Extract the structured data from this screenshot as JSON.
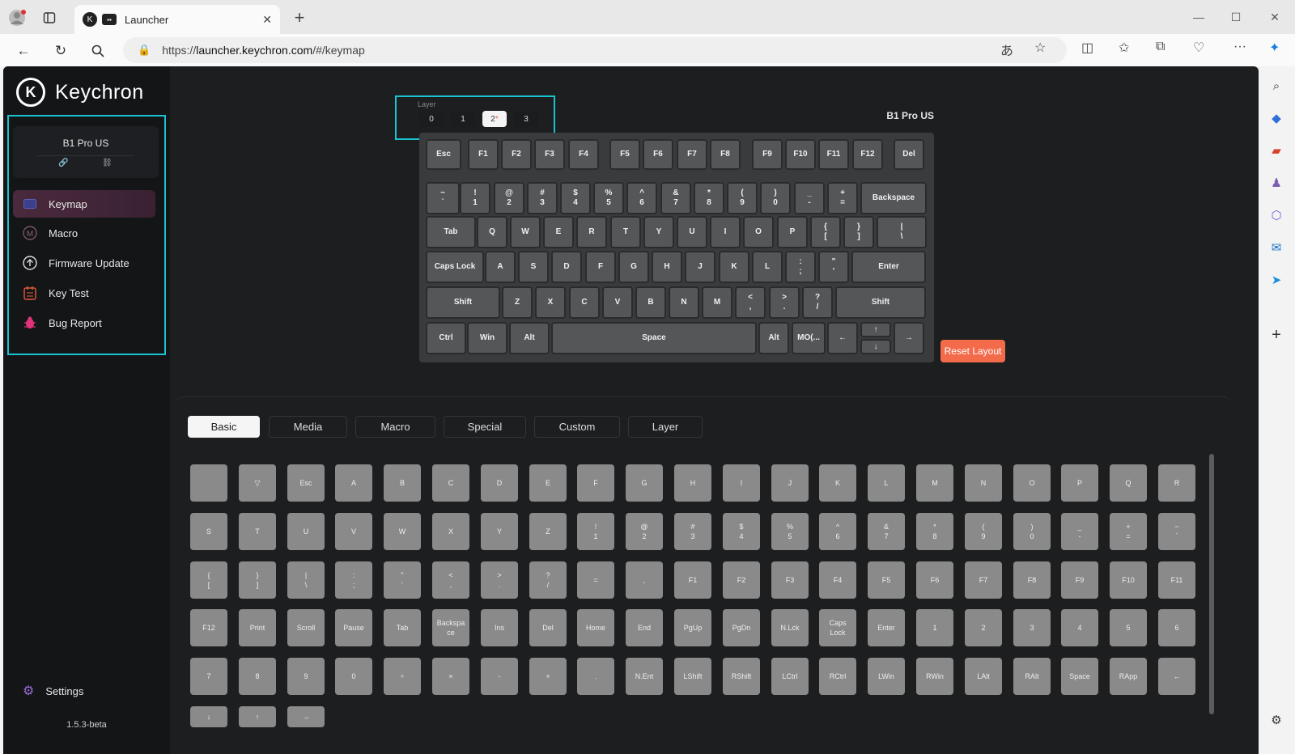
{
  "browser": {
    "tab_title": "Launcher",
    "url_prefix": "https://",
    "url_host": "launcher.keychron.com",
    "url_path": "/#/keymap"
  },
  "sidebar": {
    "brand": "Keychron",
    "device_name": "B1 Pro US",
    "items": [
      {
        "label": "Keymap",
        "icon": "keyboard-icon"
      },
      {
        "label": "Macro",
        "icon": "macro-icon"
      },
      {
        "label": "Firmware Update",
        "icon": "firmware-update-icon"
      },
      {
        "label": "Key Test",
        "icon": "key-test-icon"
      },
      {
        "label": "Bug Report",
        "icon": "bug-icon"
      }
    ],
    "settings_label": "Settings",
    "version": "1.5.3-beta"
  },
  "keymap": {
    "layer_label": "Layer",
    "layers": [
      "0",
      "1",
      "2",
      "3"
    ],
    "active_layer": "2",
    "active_layer_marker": "*",
    "keyboard_name": "B1 Pro US",
    "reset_label": "Reset Layout",
    "rows": [
      [
        [
          "Esc"
        ],
        [
          "F1"
        ],
        [
          "F2"
        ],
        [
          "F3"
        ],
        [
          "F4"
        ],
        [
          "F5"
        ],
        [
          "F6"
        ],
        [
          "F7"
        ],
        [
          "F8"
        ],
        [
          "F9"
        ],
        [
          "F10"
        ],
        [
          "F11"
        ],
        [
          "F12"
        ],
        [
          "Del"
        ]
      ],
      [
        [
          "~",
          "`"
        ],
        [
          "!",
          "1"
        ],
        [
          "@",
          "2"
        ],
        [
          "#",
          "3"
        ],
        [
          "$",
          "4"
        ],
        [
          "%",
          "5"
        ],
        [
          "^",
          "6"
        ],
        [
          "&",
          "7"
        ],
        [
          "*",
          "8"
        ],
        [
          "(",
          "9"
        ],
        [
          ")",
          "0"
        ],
        [
          "_",
          "-"
        ],
        [
          "+",
          "="
        ],
        [
          "Backspace"
        ]
      ],
      [
        [
          "Tab"
        ],
        [
          "Q"
        ],
        [
          "W"
        ],
        [
          "E"
        ],
        [
          "R"
        ],
        [
          "T"
        ],
        [
          "Y"
        ],
        [
          "U"
        ],
        [
          "I"
        ],
        [
          "O"
        ],
        [
          "P"
        ],
        [
          "{",
          "["
        ],
        [
          "}",
          "]"
        ],
        [
          "|",
          "\\"
        ]
      ],
      [
        [
          "Caps Lock"
        ],
        [
          "A"
        ],
        [
          "S"
        ],
        [
          "D"
        ],
        [
          "F"
        ],
        [
          "G"
        ],
        [
          "H"
        ],
        [
          "J"
        ],
        [
          "K"
        ],
        [
          "L"
        ],
        [
          ":",
          ";"
        ],
        [
          "\"",
          "'"
        ],
        [
          "Enter"
        ]
      ],
      [
        [
          "Shift"
        ],
        [
          "Z"
        ],
        [
          "X"
        ],
        [
          "C"
        ],
        [
          "V"
        ],
        [
          "B"
        ],
        [
          "N"
        ],
        [
          "M"
        ],
        [
          "<",
          ","
        ],
        [
          ">",
          "."
        ],
        [
          "?",
          "/"
        ],
        [
          "Shift"
        ]
      ],
      [
        [
          "Ctrl"
        ],
        [
          "Win"
        ],
        [
          "Alt"
        ],
        [
          "Space"
        ],
        [
          "Alt"
        ],
        [
          "MO(..."
        ],
        [
          "←"
        ],
        [
          "↑"
        ],
        [
          "↓"
        ],
        [
          "→"
        ]
      ]
    ]
  },
  "panel": {
    "tabs": [
      "Basic",
      "Media",
      "Macro",
      "Special",
      "Custom",
      "Layer"
    ],
    "active_tab": "Basic",
    "keys": [
      [
        ""
      ],
      [
        "▽"
      ],
      [
        "Esc"
      ],
      [
        "A"
      ],
      [
        "B"
      ],
      [
        "C"
      ],
      [
        "D"
      ],
      [
        "E"
      ],
      [
        "F"
      ],
      [
        "G"
      ],
      [
        "H"
      ],
      [
        "I"
      ],
      [
        "J"
      ],
      [
        "K"
      ],
      [
        "L"
      ],
      [
        "M"
      ],
      [
        "N"
      ],
      [
        "O"
      ],
      [
        "P"
      ],
      [
        "Q"
      ],
      [
        "R"
      ],
      [
        "S"
      ],
      [
        "T"
      ],
      [
        "U"
      ],
      [
        "V"
      ],
      [
        "W"
      ],
      [
        "X"
      ],
      [
        "Y"
      ],
      [
        "Z"
      ],
      [
        "!",
        "1"
      ],
      [
        "@",
        "2"
      ],
      [
        "#",
        "3"
      ],
      [
        "$",
        "4"
      ],
      [
        "%",
        "5"
      ],
      [
        "^",
        "6"
      ],
      [
        "&",
        "7"
      ],
      [
        "*",
        "8"
      ],
      [
        "(",
        "9"
      ],
      [
        ")",
        "0"
      ],
      [
        "_",
        "-"
      ],
      [
        "+",
        "="
      ],
      [
        "~",
        "`"
      ],
      [
        "{",
        "["
      ],
      [
        "}",
        "]"
      ],
      [
        "|",
        "\\"
      ],
      [
        ":",
        ";"
      ],
      [
        "\"",
        "'"
      ],
      [
        "<",
        ","
      ],
      [
        ">",
        "."
      ],
      [
        "?",
        "/"
      ],
      [
        "="
      ],
      [
        ","
      ],
      [
        "F1"
      ],
      [
        "F2"
      ],
      [
        "F3"
      ],
      [
        "F4"
      ],
      [
        "F5"
      ],
      [
        "F6"
      ],
      [
        "F7"
      ],
      [
        "F8"
      ],
      [
        "F9"
      ],
      [
        "F10"
      ],
      [
        "F11"
      ],
      [
        "F12"
      ],
      [
        "Print"
      ],
      [
        "Scroll"
      ],
      [
        "Pause"
      ],
      [
        "Tab"
      ],
      [
        "Backspa",
        "ce"
      ],
      [
        "Ins"
      ],
      [
        "Del"
      ],
      [
        "Home"
      ],
      [
        "End"
      ],
      [
        "PgUp"
      ],
      [
        "PgDn"
      ],
      [
        "N.Lck"
      ],
      [
        "Caps",
        "Lock"
      ],
      [
        "Enter"
      ],
      [
        "1"
      ],
      [
        "2"
      ],
      [
        "3"
      ],
      [
        "4"
      ],
      [
        "5"
      ],
      [
        "6"
      ],
      [
        "7"
      ],
      [
        "8"
      ],
      [
        "9"
      ],
      [
        "0"
      ],
      [
        "÷"
      ],
      [
        "×"
      ],
      [
        "-"
      ],
      [
        "+"
      ],
      [
        "."
      ],
      [
        "N.Ent"
      ],
      [
        "LShift"
      ],
      [
        "RShift"
      ],
      [
        "LCtrl"
      ],
      [
        "RCtrl"
      ],
      [
        "LWin"
      ],
      [
        "RWin"
      ],
      [
        "LAlt"
      ],
      [
        "RAlt"
      ],
      [
        "Space"
      ],
      [
        "RApp"
      ],
      [
        "←"
      ],
      [
        "↓"
      ],
      [
        "↑"
      ],
      [
        "→"
      ]
    ]
  },
  "colors": {
    "accent": "#f36b4a",
    "highlight": "#19c3cf"
  }
}
